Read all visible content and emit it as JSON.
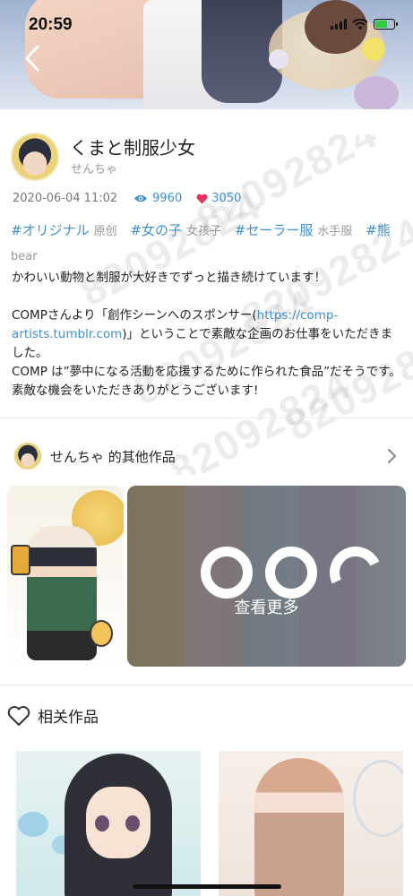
{
  "status_bar": {
    "time": "20:59"
  },
  "artwork": {
    "title": "くまと制服少女",
    "author": "せんちゃ",
    "date": "2020-06-04 11:02",
    "views": "9960",
    "likes": "3050",
    "watermark": "82092824",
    "tags": [
      {
        "tag": "#オリジナル",
        "translation": "原创"
      },
      {
        "tag": "#女の子",
        "translation": "女孩子"
      },
      {
        "tag": "#セーラー服",
        "translation": "水手服"
      },
      {
        "tag": "#熊",
        "translation": "bear"
      }
    ],
    "description": {
      "line1": "かわいい動物と制服が大好きでずっと描き続けています！",
      "line2_before": "COMPさんより「創作シーンへのスポンサー(",
      "line2_link": "https://comp-artists.tumblr.com",
      "line2_after": ")」ということで素敵な企画のお仕事をいただきました。",
      "line3": "COMP は”夢中になる活動を応援するために作られた食品”だそうです。素敵な機会をいただきありがとうございます!"
    }
  },
  "other_works": {
    "title": "せんちゃ 的其他作品",
    "more_label": "查看更多"
  },
  "related": {
    "title": "相关作品"
  },
  "icons": {
    "back": "chevron-left-icon",
    "views": "eye-icon",
    "likes": "heart-icon",
    "more": "chevron-right-icon",
    "related": "heart-outline-icon"
  },
  "colors": {
    "accent": "#3d8fd0",
    "like": "#e8345c",
    "muted": "#999999"
  }
}
